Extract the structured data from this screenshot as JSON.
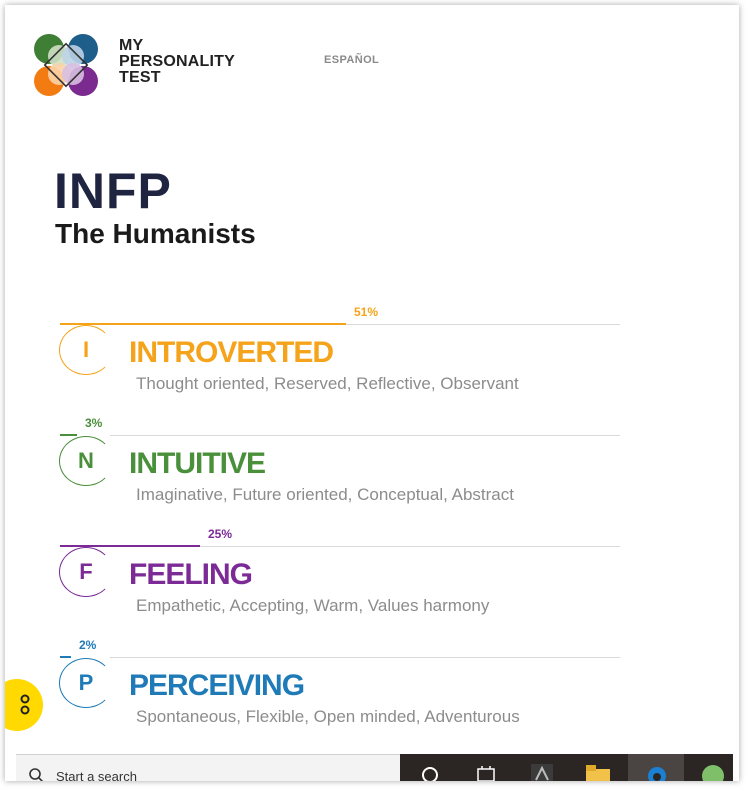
{
  "header": {
    "logo_lines": [
      "MY",
      "PERSONALITY",
      "TEST"
    ],
    "language_link": "ESPAÑOL"
  },
  "result": {
    "type_code": "INFP",
    "type_name": "The Humanists"
  },
  "traits": [
    {
      "letter": "I",
      "name": "INTROVERTED",
      "percent": 51,
      "percent_label": "51%",
      "description": "Thought oriented, Reserved, Reflective, Observant",
      "color": "#f5a31a"
    },
    {
      "letter": "N",
      "name": "INTUITIVE",
      "percent": 3,
      "percent_label": "3%",
      "description": "Imaginative, Future oriented, Conceptual, Abstract",
      "color": "#4a8f3a"
    },
    {
      "letter": "F",
      "name": "FEELING",
      "percent": 25,
      "percent_label": "25%",
      "description": "Empathetic, Accepting, Warm, Values harmony",
      "color": "#7b2a96"
    },
    {
      "letter": "P",
      "name": "PERCEIVING",
      "percent": 2,
      "percent_label": "2%",
      "description": "Spontaneous, Flexible, Open minded, Adventurous",
      "color": "#1f7ab8"
    }
  ],
  "taskbar": {
    "search_placeholder": "Start a search"
  },
  "colors": {
    "help_button": "#ffd900",
    "type_code": "#1f2440"
  }
}
